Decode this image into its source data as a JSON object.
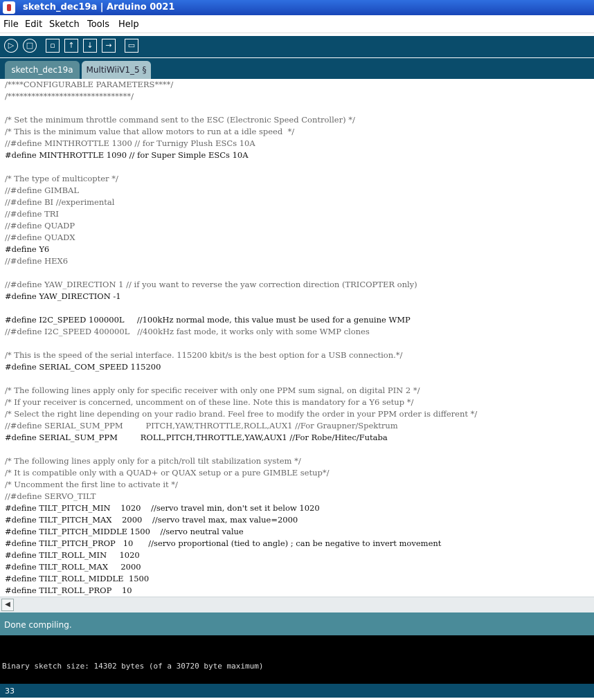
{
  "window": {
    "title": "sketch_dec19a | Arduino 0021"
  },
  "menu": [
    "File",
    "Edit",
    "Sketch",
    "Tools",
    "Help"
  ],
  "toolbar": {
    "icons": [
      "run-icon",
      "stop-icon",
      "new-icon",
      "open-icon",
      "save-icon",
      "upload-icon",
      "serial-monitor-icon"
    ]
  },
  "tabs": [
    {
      "label": "sketch_dec19a",
      "active": true
    },
    {
      "label": "MultiWiiV1_5 §",
      "active": false
    }
  ],
  "code": [
    "/****CONFIGURABLE PARAMETERS****/",
    "/*******************************/",
    "",
    "/* Set the minimum throttle command sent to the ESC (Electronic Speed Controller) */",
    "/* This is the minimum value that allow motors to run at a idle speed  */",
    "//#define MINTHROTTLE 1300 // for Turnigy Plush ESCs 10A",
    "#define MINTHROTTLE 1090 // for Super Simple ESCs 10A",
    "",
    "/* The type of multicopter */",
    "//#define GIMBAL",
    "//#define BI //experimental",
    "//#define TRI",
    "//#define QUADP",
    "//#define QUADX",
    "#define Y6",
    "//#define HEX6",
    "",
    "//#define YAW_DIRECTION 1 // if you want to reverse the yaw correction direction (TRICOPTER only)",
    "#define YAW_DIRECTION -1",
    "",
    "#define I2C_SPEED 100000L     //100kHz normal mode, this value must be used for a genuine WMP",
    "//#define I2C_SPEED 400000L   //400kHz fast mode, it works only with some WMP clones",
    "",
    "/* This is the speed of the serial interface. 115200 kbit/s is the best option for a USB connection.*/",
    "#define SERIAL_COM_SPEED 115200",
    "",
    "/* The following lines apply only for specific receiver with only one PPM sum signal, on digital PIN 2 */",
    "/* If your receiver is concerned, uncomment on of these line. Note this is mandatory for a Y6 setup */",
    "/* Select the right line depending on your radio brand. Feel free to modify the order in your PPM order is different */",
    "//#define SERIAL_SUM_PPM         PITCH,YAW,THROTTLE,ROLL,AUX1 //For Graupner/Spektrum",
    "#define SERIAL_SUM_PPM         ROLL,PITCH,THROTTLE,YAW,AUX1 //For Robe/Hitec/Futaba",
    "",
    "/* The following lines apply only for a pitch/roll tilt stabilization system */",
    "/* It is compatible only with a QUAD+ or QUAX setup or a pure GIMBLE setup*/",
    "/* Uncomment the first line to activate it */",
    "//#define SERVO_TILT",
    "#define TILT_PITCH_MIN    1020    //servo travel min, don't set it below 1020",
    "#define TILT_PITCH_MAX    2000    //servo travel max, max value=2000",
    "#define TILT_PITCH_MIDDLE 1500    //servo neutral value",
    "#define TILT_PITCH_PROP   10      //servo proportional (tied to angle) ; can be negative to invert movement",
    "#define TILT_ROLL_MIN     1020",
    "#define TILT_ROLL_MAX     2000",
    "#define TILT_ROLL_MIDDLE  1500",
    "#define TILT_ROLL_PROP    10"
  ],
  "status": {
    "message": "Done compiling."
  },
  "console": {
    "output": "Binary sketch size: 14302 bytes (of a 30720 byte maximum)"
  },
  "footer": {
    "line_number": "33"
  }
}
